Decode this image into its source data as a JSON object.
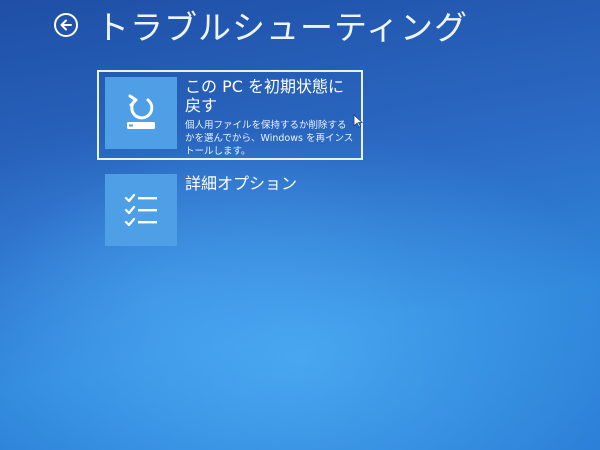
{
  "header": {
    "title": "トラブルシューティング",
    "back_icon": "back-arrow-icon"
  },
  "options": [
    {
      "title": "この PC を初期状態に戻す",
      "description": "個人用ファイルを保持するか削除するかを選んでから、Windows を再インストールします。",
      "icon": "reset-pc-icon"
    },
    {
      "title": "詳細オプション",
      "icon": "checklist-icon"
    }
  ],
  "colors": {
    "background": "#2b6ac4",
    "tile": "#4f9fe6",
    "text": "#ffffff"
  }
}
